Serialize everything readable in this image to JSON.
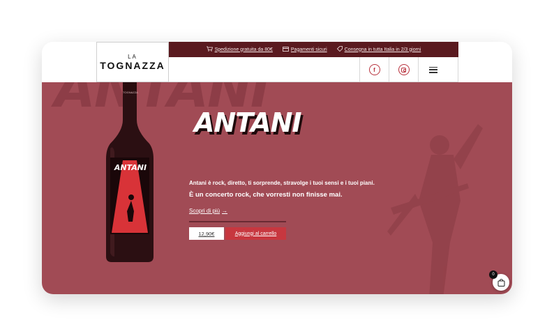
{
  "logo": {
    "small": "LA",
    "name": "TOGNAZZA"
  },
  "topbar": {
    "items": [
      {
        "icon": "cart-icon",
        "label": "Spedizione gratuita da 80€"
      },
      {
        "icon": "card-icon",
        "label": "Pagamenti sicuri"
      },
      {
        "icon": "tag-icon",
        "label": "Consegna in tutta Italia in 2/3 giorni"
      }
    ]
  },
  "nav": {
    "facebook": "f",
    "icons": [
      "facebook-icon",
      "instagram-icon",
      "hamburger-menu-icon"
    ]
  },
  "hero": {
    "bg_word": "ANTANI",
    "title": "ANTANI",
    "bottle_label": "ANTANI",
    "bottle_brand": "TOGNAZZA",
    "description_1": "Antani è rock, diretto, ti sorprende, stravolge i tuoi sensi e i tuoi piani.",
    "description_2": "È un concerto rock, che vorresti non finisse mai.",
    "more_label": "Scopri di più",
    "more_arrow": "→",
    "price": "12,90€",
    "add_to_cart": "Aggiungi al carrello"
  },
  "cart": {
    "count": "0"
  },
  "colors": {
    "hero_bg": "#a14b55",
    "topbar_bg": "#5a1a1f",
    "accent": "#c7373f"
  }
}
